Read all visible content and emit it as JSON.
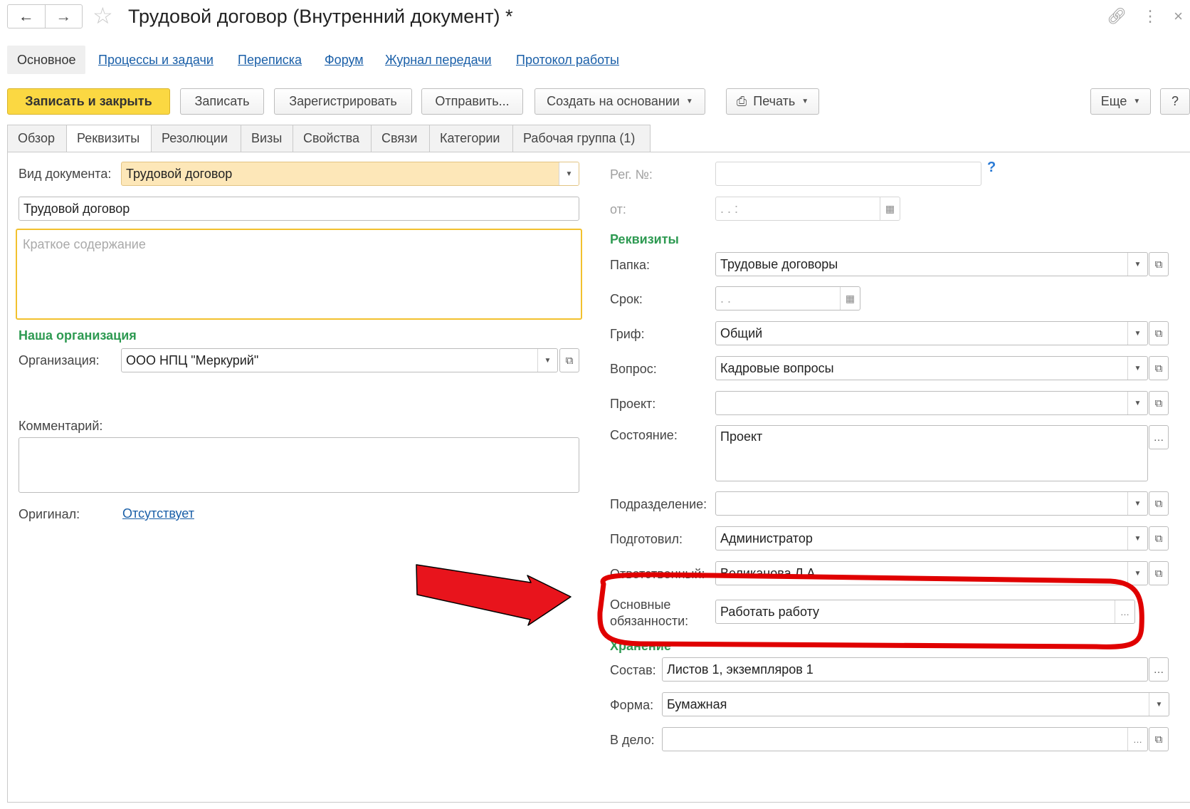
{
  "window": {
    "title": "Трудовой договор (Внутренний документ) *",
    "icons": {
      "back": "arrow-left-icon",
      "forward": "arrow-right-icon",
      "favorite": "star-icon",
      "link": "link-icon",
      "menu": "more-vertical-icon",
      "close": "close-icon"
    }
  },
  "section_tabs": [
    "Основное",
    "Процессы и задачи",
    "Переписка",
    "Форум",
    "Журнал передачи",
    "Протокол работы"
  ],
  "toolbar": {
    "save_close": "Записать и закрыть",
    "save": "Записать",
    "register": "Зарегистрировать",
    "send": "Отправить...",
    "create_based": "Создать на основании",
    "print": "Печать",
    "more": "Еще",
    "help": "?"
  },
  "tabs": [
    "Обзор",
    "Реквизиты",
    "Резолюции",
    "Визы",
    "Свойства",
    "Связи",
    "Категории",
    "Рабочая группа (1)"
  ],
  "left": {
    "doc_type_label": "Вид документа:",
    "doc_type_value": "Трудовой договор",
    "title_value": "Трудовой договор",
    "summary_placeholder": "Краткое содержание",
    "org_section": "Наша организация",
    "org_label": "Организация:",
    "org_value": "ООО НПЦ \"Меркурий\"",
    "comment_label": "Комментарий:",
    "original_label": "Оригинал:",
    "original_value": "Отсутствует"
  },
  "right": {
    "reg_label": "Рег. №:",
    "reg_help": "?",
    "date_label": "от:",
    "date_value": " .  .      :  ",
    "req_section": "Реквизиты",
    "folder_label": "Папка:",
    "folder_value": "Трудовые договоры",
    "term_label": "Срок:",
    "term_value": " .  .",
    "grif_label": "Гриф:",
    "grif_value": "Общий",
    "question_label": "Вопрос:",
    "question_value": "Кадровые вопросы",
    "project_label": "Проект:",
    "state_label": "Состояние:",
    "state_value": "Проект",
    "dept_label": "Подразделение:",
    "prepared_label": "Подготовил:",
    "prepared_value": "Администратор",
    "resp_label": "Ответственный:",
    "resp_value": "Великанова Л.А.",
    "duties_label_1": "Основные",
    "duties_label_2": "обязанности:",
    "duties_value": "Работать работу",
    "storage_section": "Хранение",
    "composition_label": "Состав:",
    "composition_value": "Листов 1, экземпляров 1",
    "form_label": "Форма:",
    "form_value": "Бумажная",
    "case_label": "В дело:"
  },
  "annotation": {
    "highlight_color": "#e00000",
    "arrow_color": "#e8141c"
  }
}
